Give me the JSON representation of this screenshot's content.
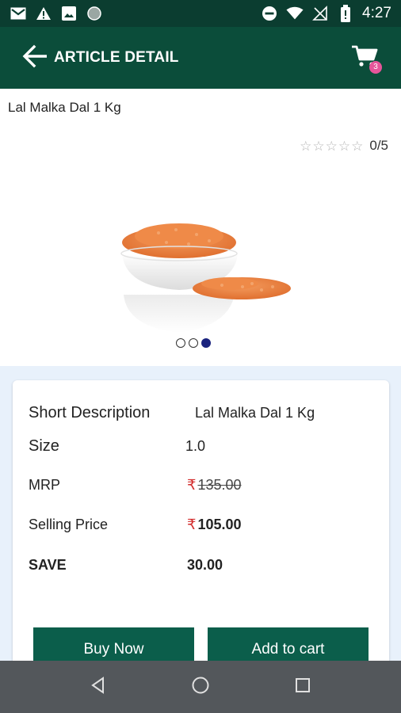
{
  "status_bar": {
    "time": "4:27",
    "icons": [
      "gmail-icon",
      "alert-icon",
      "image-icon",
      "circle-icon",
      "do-not-disturb-icon",
      "wifi-icon",
      "no-sim-icon",
      "battery-icon"
    ]
  },
  "app_bar": {
    "title": "ARTICLE DETAIL",
    "cart_count": "3"
  },
  "product": {
    "name": "Lal Malka Dal 1 Kg",
    "rating_text": "0/5",
    "rating_value": 0,
    "rating_max": 5,
    "carousel_count": 3,
    "carousel_active": 2
  },
  "details": {
    "short_description_label": "Short Description",
    "short_description_value": "Lal Malka Dal 1 Kg",
    "size_label": "Size",
    "size_value": "1.0",
    "mrp_label": "MRP",
    "mrp_value": "135.00",
    "selling_price_label": "Selling Price",
    "selling_price_value": "105.00",
    "save_label": "SAVE",
    "save_value": "30.00",
    "currency_symbol": "₹"
  },
  "actions": {
    "buy_now_label": "Buy Now",
    "add_to_cart_label": "Add to cart"
  },
  "colors": {
    "app_bar": "#0b4d3a",
    "status_bar": "#0b3d30",
    "button": "#0b5e4b",
    "badge": "#e6559a",
    "currency": "#d32f2f",
    "dot_active": "#1a237e"
  }
}
